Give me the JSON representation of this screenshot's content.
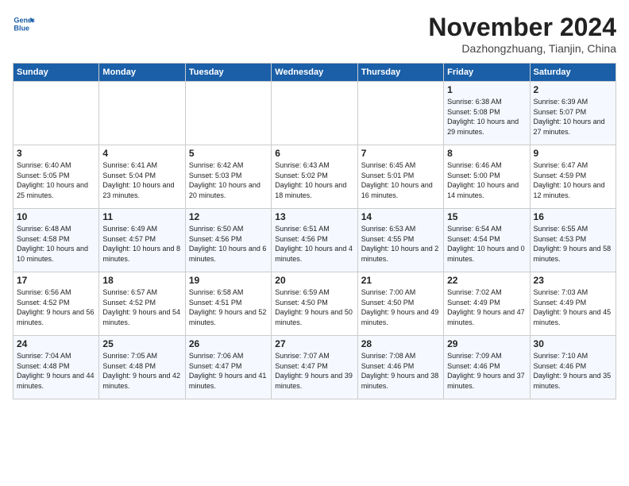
{
  "header": {
    "logo_line1": "General",
    "logo_line2": "Blue",
    "month": "November 2024",
    "location": "Dazhongzhuang, Tianjin, China"
  },
  "weekdays": [
    "Sunday",
    "Monday",
    "Tuesday",
    "Wednesday",
    "Thursday",
    "Friday",
    "Saturday"
  ],
  "weeks": [
    [
      {
        "day": "",
        "info": ""
      },
      {
        "day": "",
        "info": ""
      },
      {
        "day": "",
        "info": ""
      },
      {
        "day": "",
        "info": ""
      },
      {
        "day": "",
        "info": ""
      },
      {
        "day": "1",
        "info": "Sunrise: 6:38 AM\nSunset: 5:08 PM\nDaylight: 10 hours and 29 minutes."
      },
      {
        "day": "2",
        "info": "Sunrise: 6:39 AM\nSunset: 5:07 PM\nDaylight: 10 hours and 27 minutes."
      }
    ],
    [
      {
        "day": "3",
        "info": "Sunrise: 6:40 AM\nSunset: 5:05 PM\nDaylight: 10 hours and 25 minutes."
      },
      {
        "day": "4",
        "info": "Sunrise: 6:41 AM\nSunset: 5:04 PM\nDaylight: 10 hours and 23 minutes."
      },
      {
        "day": "5",
        "info": "Sunrise: 6:42 AM\nSunset: 5:03 PM\nDaylight: 10 hours and 20 minutes."
      },
      {
        "day": "6",
        "info": "Sunrise: 6:43 AM\nSunset: 5:02 PM\nDaylight: 10 hours and 18 minutes."
      },
      {
        "day": "7",
        "info": "Sunrise: 6:45 AM\nSunset: 5:01 PM\nDaylight: 10 hours and 16 minutes."
      },
      {
        "day": "8",
        "info": "Sunrise: 6:46 AM\nSunset: 5:00 PM\nDaylight: 10 hours and 14 minutes."
      },
      {
        "day": "9",
        "info": "Sunrise: 6:47 AM\nSunset: 4:59 PM\nDaylight: 10 hours and 12 minutes."
      }
    ],
    [
      {
        "day": "10",
        "info": "Sunrise: 6:48 AM\nSunset: 4:58 PM\nDaylight: 10 hours and 10 minutes."
      },
      {
        "day": "11",
        "info": "Sunrise: 6:49 AM\nSunset: 4:57 PM\nDaylight: 10 hours and 8 minutes."
      },
      {
        "day": "12",
        "info": "Sunrise: 6:50 AM\nSunset: 4:56 PM\nDaylight: 10 hours and 6 minutes."
      },
      {
        "day": "13",
        "info": "Sunrise: 6:51 AM\nSunset: 4:56 PM\nDaylight: 10 hours and 4 minutes."
      },
      {
        "day": "14",
        "info": "Sunrise: 6:53 AM\nSunset: 4:55 PM\nDaylight: 10 hours and 2 minutes."
      },
      {
        "day": "15",
        "info": "Sunrise: 6:54 AM\nSunset: 4:54 PM\nDaylight: 10 hours and 0 minutes."
      },
      {
        "day": "16",
        "info": "Sunrise: 6:55 AM\nSunset: 4:53 PM\nDaylight: 9 hours and 58 minutes."
      }
    ],
    [
      {
        "day": "17",
        "info": "Sunrise: 6:56 AM\nSunset: 4:52 PM\nDaylight: 9 hours and 56 minutes."
      },
      {
        "day": "18",
        "info": "Sunrise: 6:57 AM\nSunset: 4:52 PM\nDaylight: 9 hours and 54 minutes."
      },
      {
        "day": "19",
        "info": "Sunrise: 6:58 AM\nSunset: 4:51 PM\nDaylight: 9 hours and 52 minutes."
      },
      {
        "day": "20",
        "info": "Sunrise: 6:59 AM\nSunset: 4:50 PM\nDaylight: 9 hours and 50 minutes."
      },
      {
        "day": "21",
        "info": "Sunrise: 7:00 AM\nSunset: 4:50 PM\nDaylight: 9 hours and 49 minutes."
      },
      {
        "day": "22",
        "info": "Sunrise: 7:02 AM\nSunset: 4:49 PM\nDaylight: 9 hours and 47 minutes."
      },
      {
        "day": "23",
        "info": "Sunrise: 7:03 AM\nSunset: 4:49 PM\nDaylight: 9 hours and 45 minutes."
      }
    ],
    [
      {
        "day": "24",
        "info": "Sunrise: 7:04 AM\nSunset: 4:48 PM\nDaylight: 9 hours and 44 minutes."
      },
      {
        "day": "25",
        "info": "Sunrise: 7:05 AM\nSunset: 4:48 PM\nDaylight: 9 hours and 42 minutes."
      },
      {
        "day": "26",
        "info": "Sunrise: 7:06 AM\nSunset: 4:47 PM\nDaylight: 9 hours and 41 minutes."
      },
      {
        "day": "27",
        "info": "Sunrise: 7:07 AM\nSunset: 4:47 PM\nDaylight: 9 hours and 39 minutes."
      },
      {
        "day": "28",
        "info": "Sunrise: 7:08 AM\nSunset: 4:46 PM\nDaylight: 9 hours and 38 minutes."
      },
      {
        "day": "29",
        "info": "Sunrise: 7:09 AM\nSunset: 4:46 PM\nDaylight: 9 hours and 37 minutes."
      },
      {
        "day": "30",
        "info": "Sunrise: 7:10 AM\nSunset: 4:46 PM\nDaylight: 9 hours and 35 minutes."
      }
    ]
  ]
}
